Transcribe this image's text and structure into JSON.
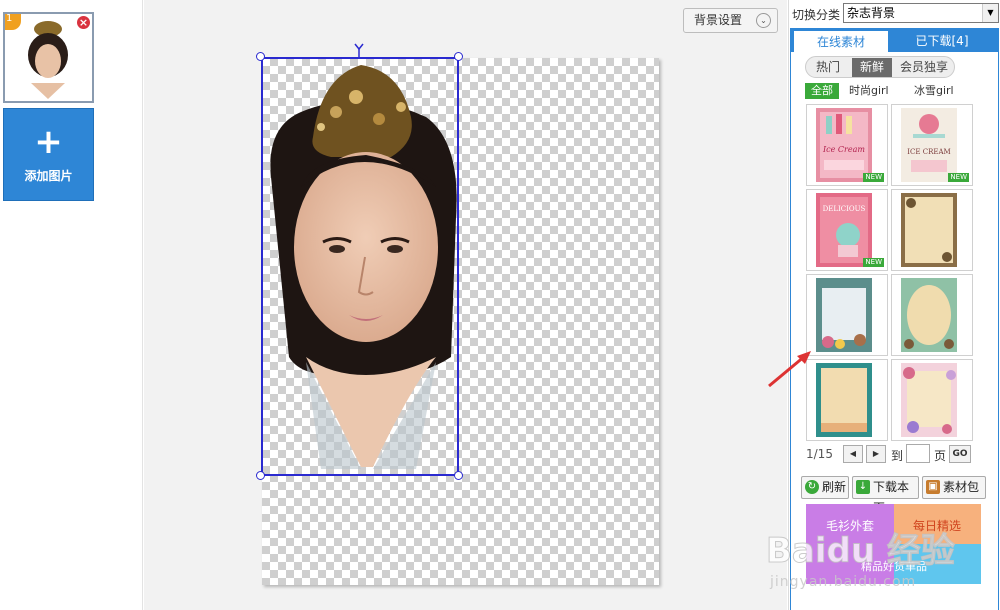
{
  "thumbnails": [
    {
      "number": "1",
      "close_icon": "close-icon"
    }
  ],
  "add_image": {
    "plus": "+",
    "label": "添加图片"
  },
  "canvas": {
    "bg_settings_label": "背景设置",
    "chevron": "⌄"
  },
  "right_panel": {
    "category_label": "切换分类",
    "category_value": "杂志背景",
    "dropdown_arrow": "▼",
    "tabs": [
      {
        "label": "在线素材",
        "active": true
      },
      {
        "label": "已下载[4]",
        "active": false
      }
    ],
    "pills": [
      "热门",
      "新鲜",
      "会员独享"
    ],
    "pills_active": "新鲜",
    "subfilters": [
      "全部",
      "时尚girl",
      "冰雪girl"
    ],
    "subfilters_active": "全部",
    "new_badge": "NEW",
    "pager": {
      "page_text": "1/15",
      "prev": "◀",
      "next": "▶",
      "goto_label": "到",
      "page_unit": "页",
      "go_label": "GO"
    },
    "actions": [
      {
        "label": "刷新",
        "icon": "refresh-icon"
      },
      {
        "label": "下载本页",
        "icon": "download-icon"
      },
      {
        "label": "素材包",
        "icon": "package-icon"
      }
    ],
    "ad": {
      "text_left": "毛衫外套",
      "text_right": "每日精选",
      "text_bottom": "精品好货单品"
    }
  },
  "watermark": {
    "brand": "Baidu 经验",
    "url": "jingyan.baidu.com"
  },
  "colors": {
    "accent": "#2e86d6",
    "selection": "#2a2ad0",
    "green": "#3aa93a",
    "annotation_arrow": "#d33"
  }
}
